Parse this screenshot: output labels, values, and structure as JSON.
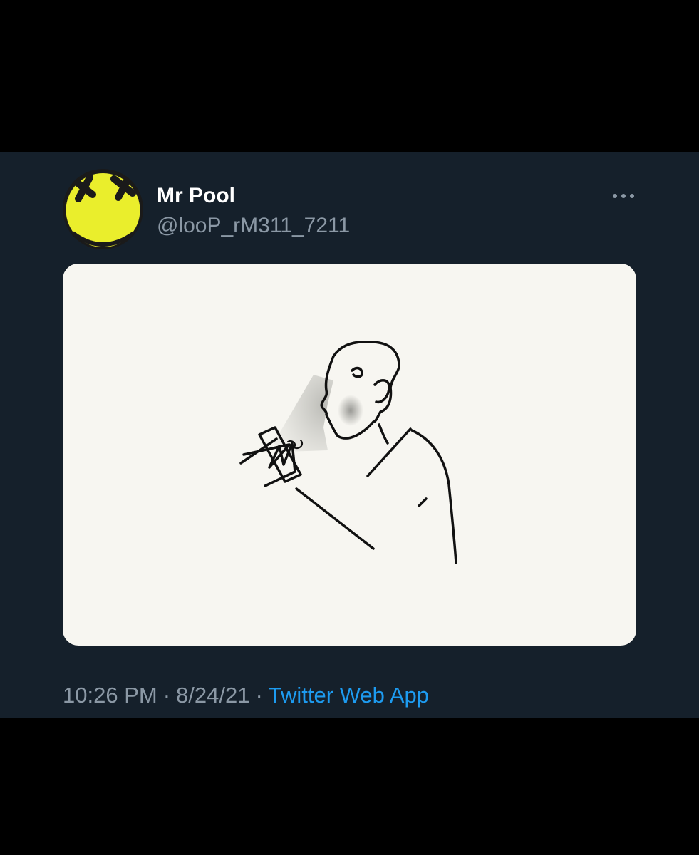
{
  "tweet": {
    "display_name": "Mr Pool",
    "handle": "@looP_rM311_7211",
    "time": "10:26 PM",
    "date": "8/24/21",
    "separator": "·",
    "source": "Twitter Web App"
  },
  "icons": {
    "avatar": "yellow-smiley-x-eyes-avatar",
    "more": "more-options-icon"
  },
  "colors": {
    "background": "#15202b",
    "text_primary": "#ffffff",
    "text_secondary": "#8b98a5",
    "link": "#1d9bf0",
    "avatar_yellow": "#eaee2c",
    "media_background": "#f7f6f1"
  }
}
